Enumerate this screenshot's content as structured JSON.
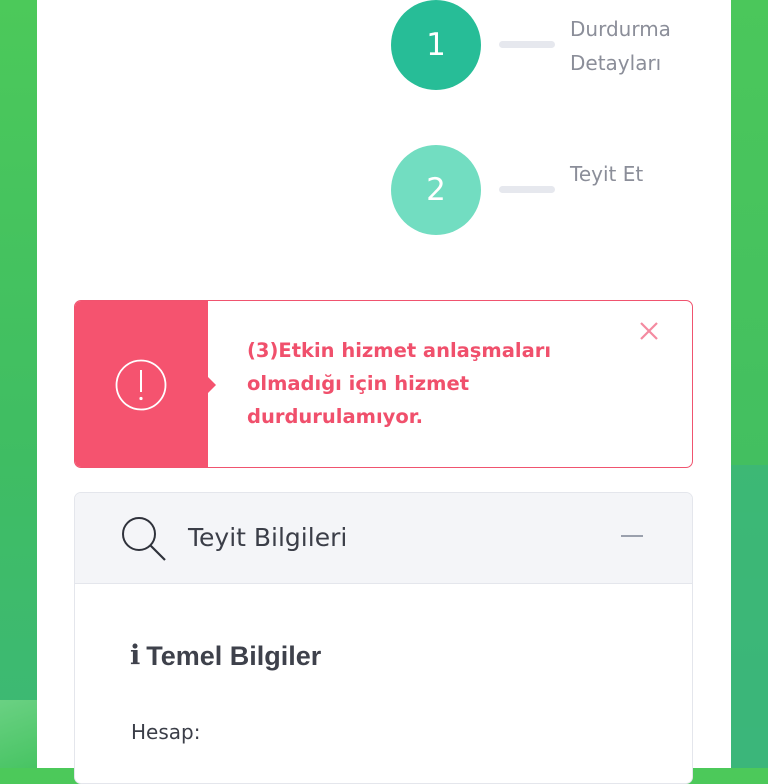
{
  "steps": [
    {
      "number": "1",
      "label": "Durdurma Detayları",
      "color": "#27bd97"
    },
    {
      "number": "2",
      "label": "Teyit Et",
      "color": "#72ddc1"
    }
  ],
  "alert": {
    "message": "(3)Etkin hizmet anlaşmaları olmadığı için hizmet durdurulamıyor.",
    "color": "#f5536f",
    "icon": "alert-circle-icon"
  },
  "confirmation": {
    "title": "Teyit Bilgileri",
    "section_title": "Temel Bilgiler",
    "fields": [
      {
        "label": "Hesap:"
      }
    ]
  },
  "colors": {
    "background": "#4cc95a",
    "card": "#ffffff",
    "muted_text": "#8b8e99"
  }
}
